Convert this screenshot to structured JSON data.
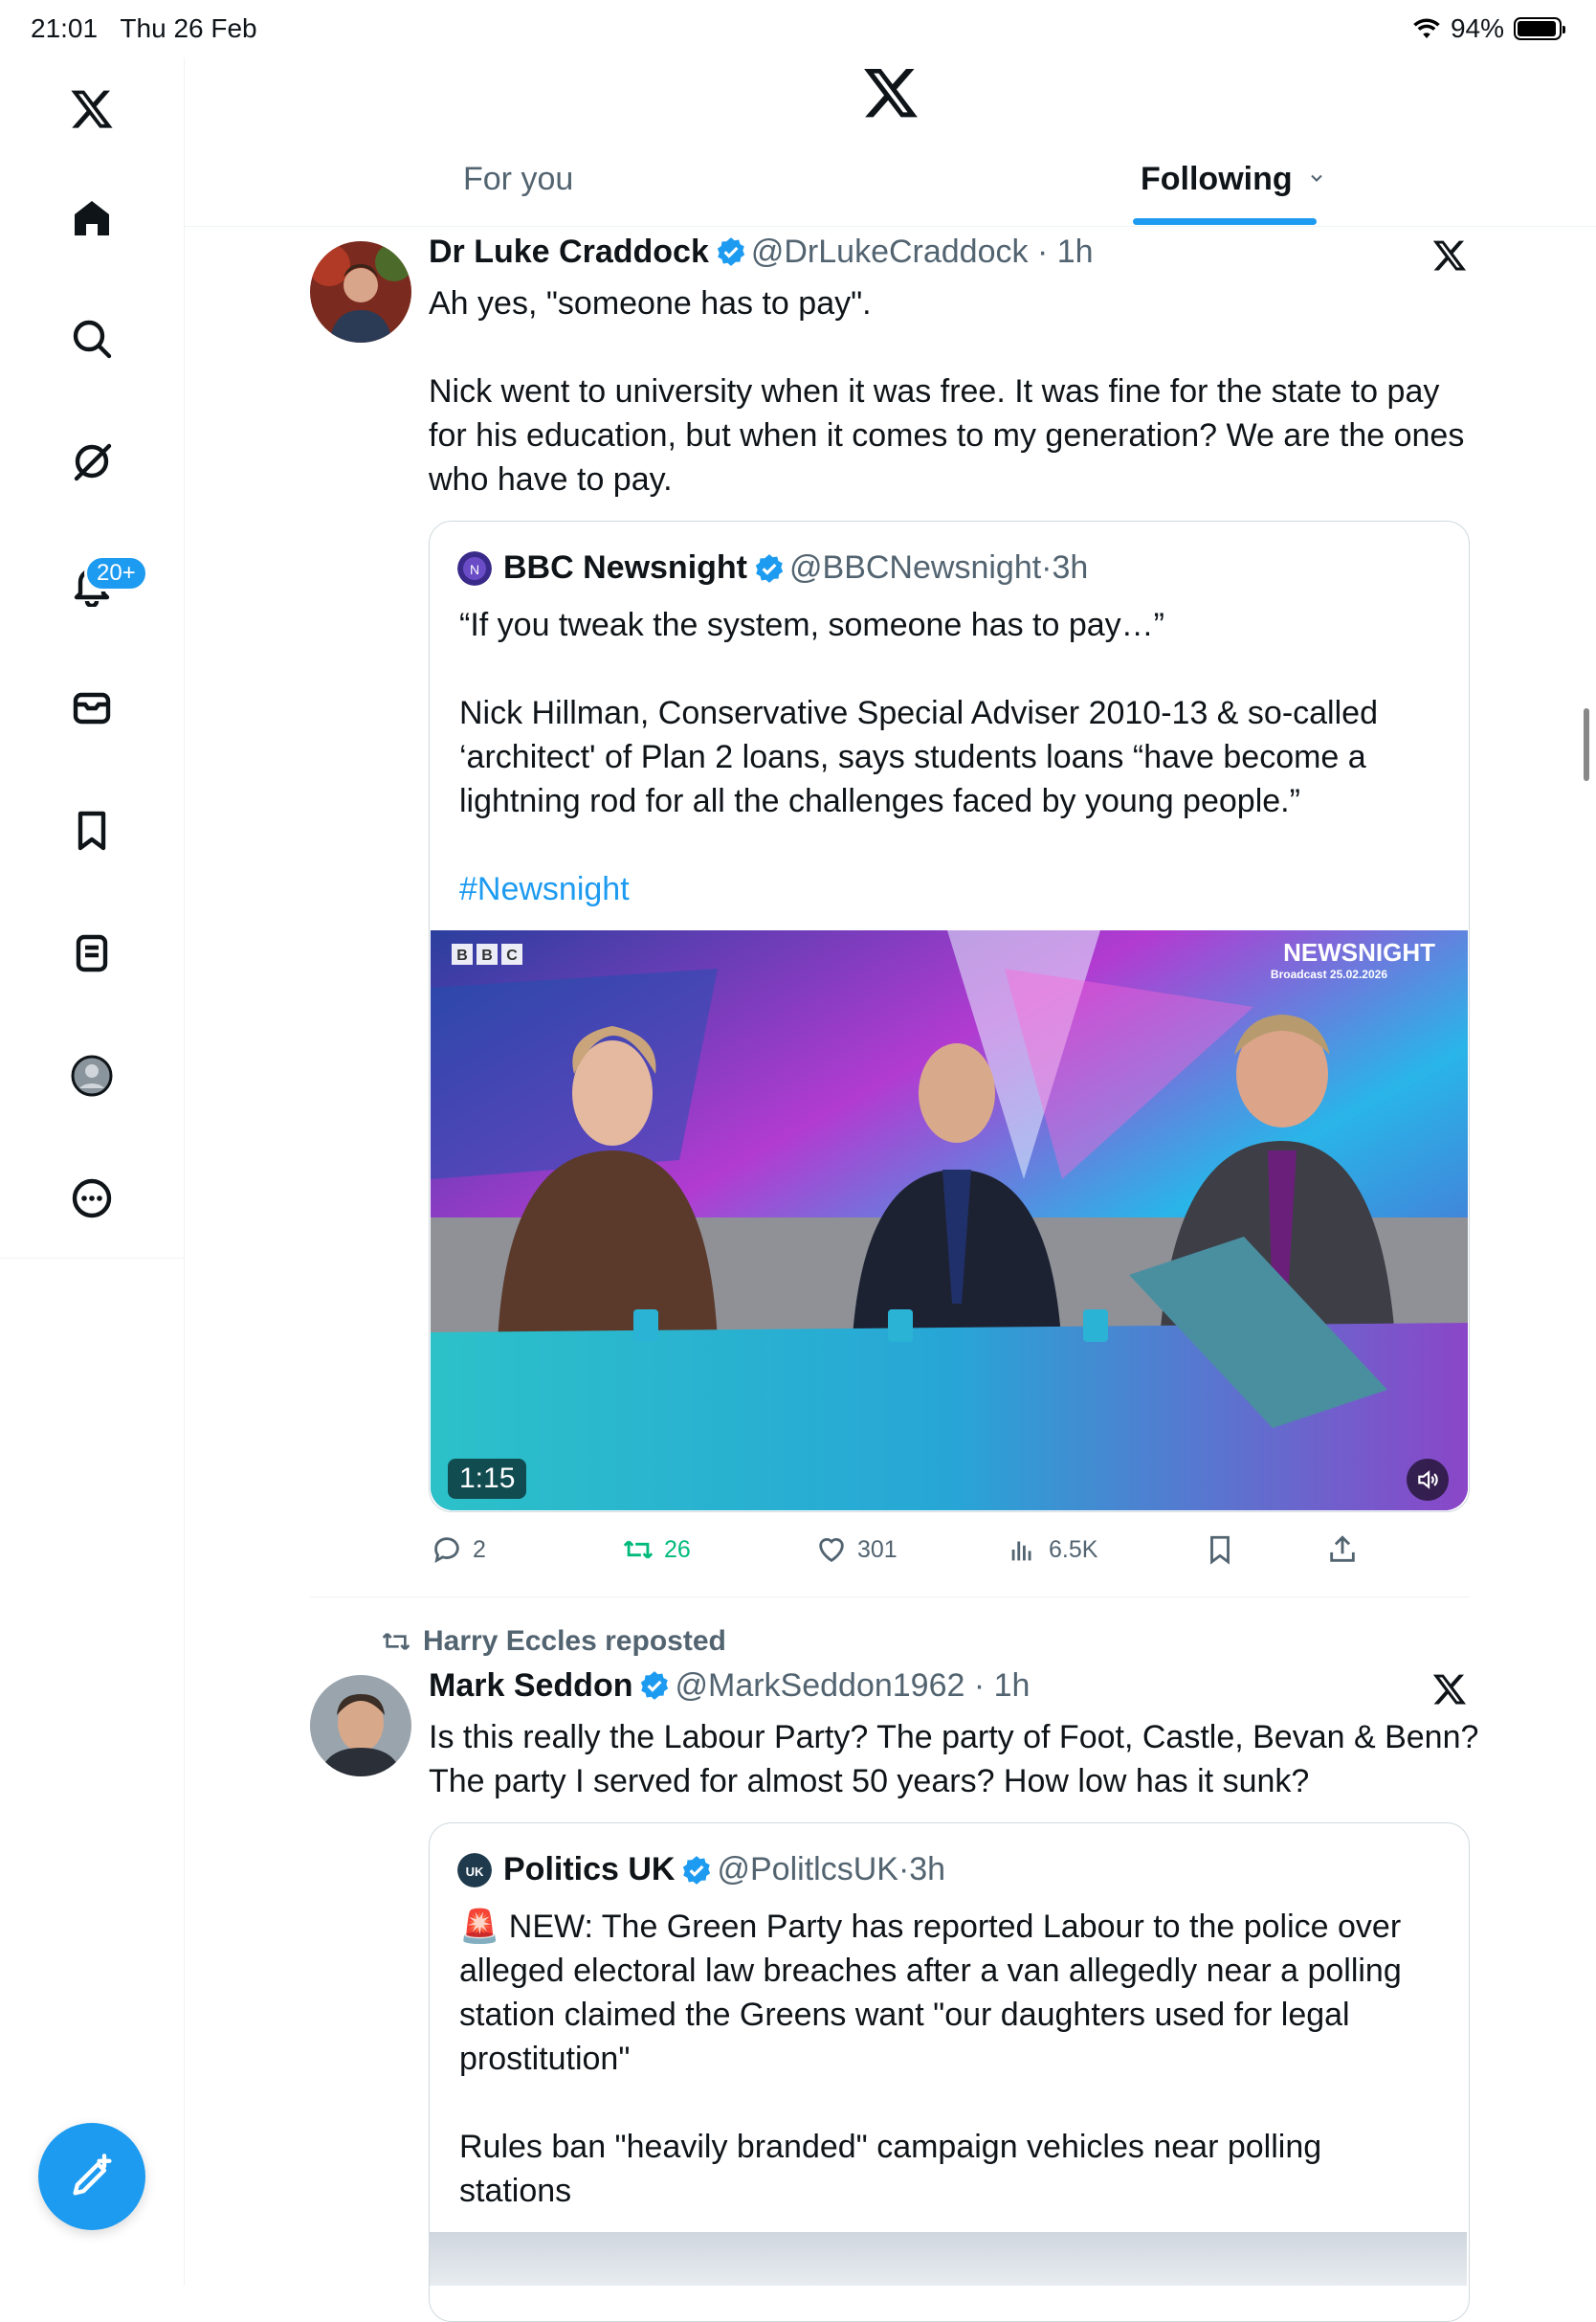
{
  "status_bar": {
    "time": "21:01",
    "date": "Thu 26 Feb",
    "battery": "94%"
  },
  "sidebar": {
    "items": [
      "x-logo-icon",
      "home-icon",
      "search-icon",
      "grok-icon",
      "notifications-icon",
      "messages-icon",
      "bookmarks-icon",
      "lists-icon",
      "profile-icon",
      "more-icon"
    ],
    "notifications_badge": "20+"
  },
  "header": {
    "tabs": [
      {
        "label": "For you"
      },
      {
        "label": "Following"
      }
    ]
  },
  "tweets": [
    {
      "name": "Dr Luke Craddock",
      "handle": "@DrLukeCraddock",
      "time": "1h",
      "text": "Ah yes, \"someone has to pay\".\n\nNick went to university when it was free. It was fine for the state to pay\nfor his education, but when it comes to my generation? We are the ones\nwho have to pay.",
      "quote": {
        "name": "BBC Newsnight",
        "handle": "@BBCNewsnight",
        "time": "3h",
        "text": "“If you tweak the system, someone has to pay…”\n\nNick Hillman, Conservative Special Adviser 2010-13 & so-called\n‘architect' of Plan 2 loans, says students loans “have become a\nlightning rod for all the challenges faced by young people.”",
        "hashtag": "#Newsnight",
        "video": {
          "duration": "1:15",
          "overlay_brand": "BBC",
          "overlay_title": "NEWSNIGHT",
          "overlay_sub": "Broadcast 25.02.2026"
        }
      },
      "stats": {
        "replies": "2",
        "reposts": "26",
        "likes": "301",
        "views": "6.5K"
      }
    },
    {
      "repost_label": "Harry Eccles reposted",
      "name": "Mark Seddon",
      "handle": "@MarkSeddon1962",
      "time": "1h",
      "text": "Is this really the Labour Party? The party of Foot, Castle, Bevan & Benn?\nThe party I served for almost 50 years? How low has it sunk?",
      "quote": {
        "name": "Politics UK",
        "handle": "@PolitlcsUK",
        "time": "3h",
        "text": "🚨 NEW: The Green Party has reported Labour to the police over\nalleged electoral law breaches after a van allegedly near a polling\nstation claimed the Greens want \"our daughters used for legal\nprostitution\"\n\nRules ban \"heavily branded\" campaign vehicles near polling\nstations"
      }
    }
  ],
  "colors": {
    "accent": "#1d9bf0",
    "repost_green": "#00ba7c",
    "muted": "#536471"
  }
}
